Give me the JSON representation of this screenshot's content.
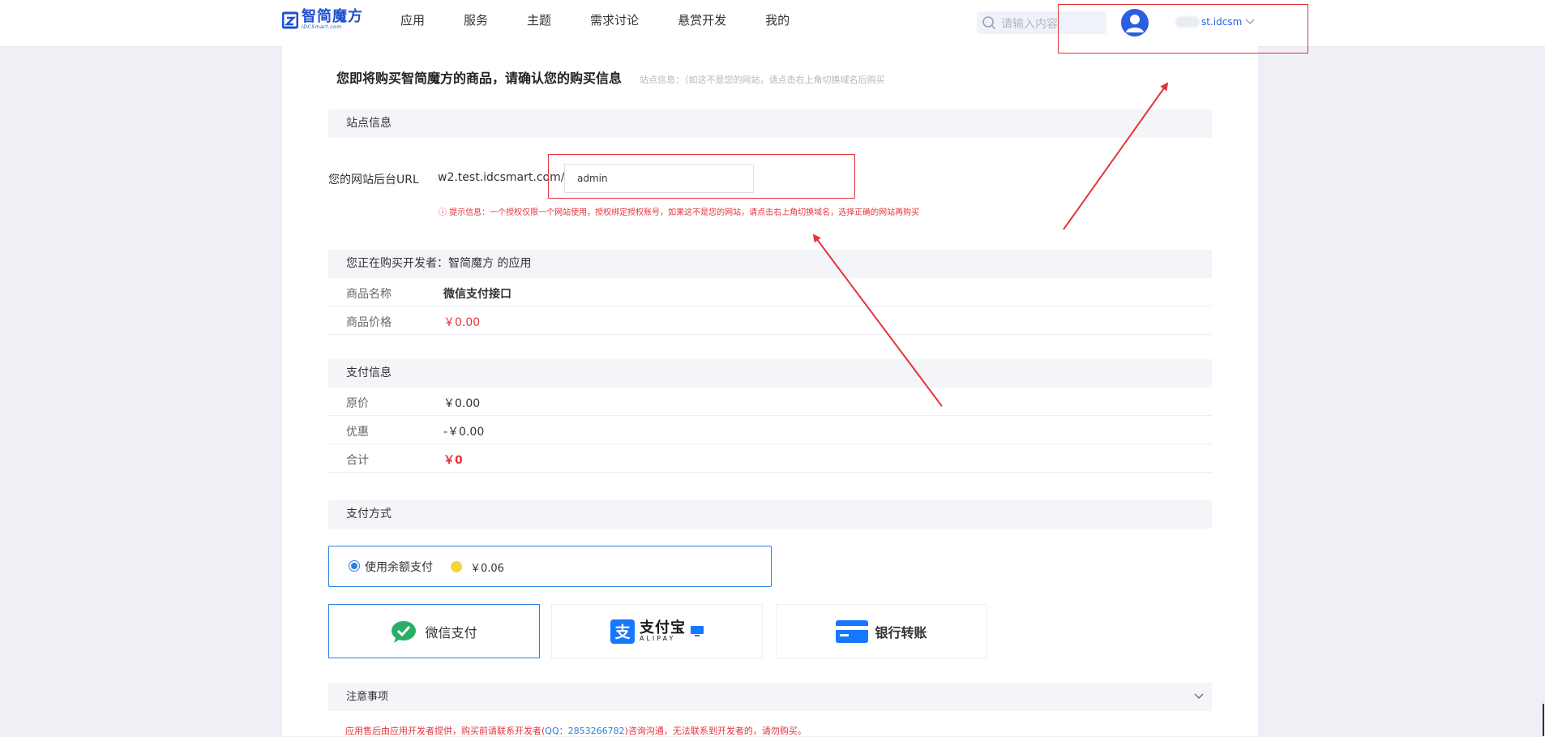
{
  "header": {
    "logo_cn": "智简魔方",
    "logo_en": "IDCSmart.com",
    "nav": [
      {
        "label": "应用"
      },
      {
        "label": "服务"
      },
      {
        "label": "主题"
      },
      {
        "label": "需求讨论"
      },
      {
        "label": "悬赏开发"
      },
      {
        "label": "我的"
      }
    ],
    "search_placeholder": "请输入内容",
    "username": "st.idcsm"
  },
  "page": {
    "title": "您即将购买智简魔方的商品，请确认您的购买信息",
    "site_hint": "站点信息：（如这不是您的网站，请点击右上角切换域名后购买"
  },
  "site_info": {
    "heading": "站点信息",
    "url_label": "您的网站后台URL",
    "url_prefix": "w2.test.idcsmart.com/",
    "url_value": "admin",
    "warning": "ⓘ 提示信息：一个授权仅限一个网站使用，授权绑定授权账号，如果这不是您的网站，请点击右上角切换域名，选择正确的网站再购买"
  },
  "product": {
    "heading": "您正在购买开发者：智简魔方 的应用",
    "rows": [
      {
        "label": "商品名称",
        "value": "微信支付接口"
      },
      {
        "label": "商品价格",
        "value": "￥0.00"
      }
    ]
  },
  "payment_info": {
    "heading": "支付信息",
    "rows": [
      {
        "label": "原价",
        "value": "￥0.00"
      },
      {
        "label": "优惠",
        "value": "-￥0.00"
      },
      {
        "label": "合计",
        "value": "￥0"
      }
    ]
  },
  "payment_method": {
    "heading": "支付方式",
    "balance_label": "使用余额支付",
    "balance_amount": "￥0.06",
    "options": {
      "wechat": "微信支付",
      "alipay_cn": "支付宝",
      "alipay_en": "ALIPAY",
      "bank": "银行转账"
    }
  },
  "notice": {
    "heading": "注意事项",
    "text_before": "应用售后由应用开发者提供，购买前请联系开发者(",
    "qq": "QQ：2853266782",
    "text_after": ")咨询沟通，无法联系到开发者的，请勿购买。"
  },
  "colors": {
    "accent": "#2a7fe0",
    "brand": "#1f4fd1",
    "danger": "#e5343b",
    "wechat": "#2aae67",
    "alipay": "#1677ff",
    "coin": "#f7d33c"
  }
}
